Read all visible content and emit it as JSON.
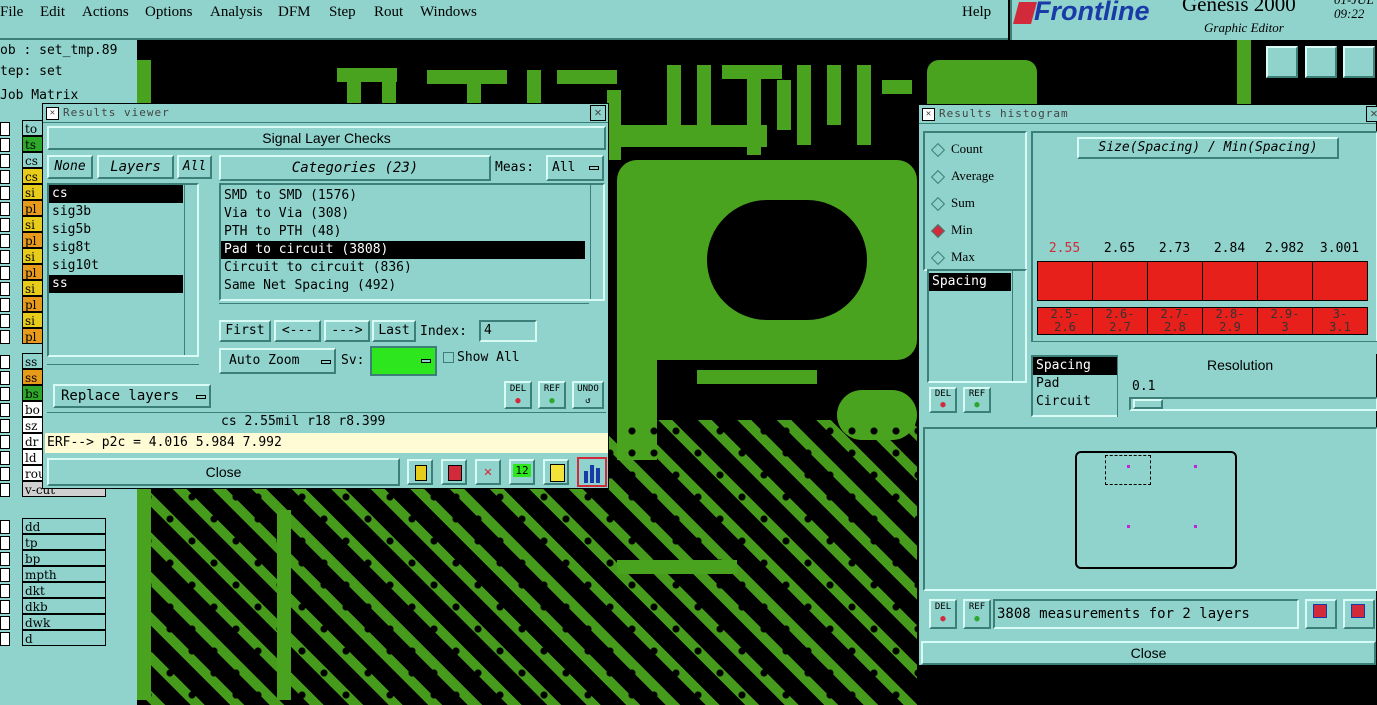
{
  "menubar": {
    "items": [
      "File",
      "Edit",
      "Actions",
      "Options",
      "Analysis",
      "DFM",
      "Step",
      "Rout",
      "Windows"
    ],
    "help": "Help"
  },
  "brand": {
    "logo": "Frontline",
    "product": "Genesis 2000",
    "subtitle": "Graphic Editor",
    "date_fragment": "01-JUL",
    "time": "09:22"
  },
  "left_panel": {
    "job_label": "ob : set_tmp.89",
    "step_label": "tep: set",
    "job_matrix": "Job Matrix",
    "layers_top": [
      "to",
      "ts",
      "cs",
      "cs",
      "si",
      "pl",
      "si",
      "pl",
      "si",
      "pl",
      "si",
      "pl",
      "si",
      "pl"
    ],
    "layers_mid": [
      "ss",
      "ss",
      "bs",
      "bo",
      "sz",
      "dr",
      "ld",
      "rou",
      "v-cut"
    ],
    "layers_bottom": [
      "dd",
      "tp",
      "bp",
      "mpth",
      "dkt",
      "dkb",
      "dwk",
      "d"
    ]
  },
  "results_viewer": {
    "title": "Results viewer",
    "header": "Signal Layer Checks",
    "none_btn": "None",
    "layers_btn": "Layers",
    "all_btn": "All",
    "categories_btn": "Categories (23)",
    "meas_label": "Meas:",
    "meas_value": "All",
    "layers": [
      {
        "name": "cs",
        "selected": true
      },
      {
        "name": "sig3b",
        "selected": false
      },
      {
        "name": "sig5b",
        "selected": false
      },
      {
        "name": "sig8t",
        "selected": false
      },
      {
        "name": "sig10t",
        "selected": false
      },
      {
        "name": "ss",
        "selected": true
      }
    ],
    "categories": [
      {
        "name": "SMD to SMD (1576)",
        "selected": false
      },
      {
        "name": "Via to Via (308)",
        "selected": false
      },
      {
        "name": "PTH to PTH (48)",
        "selected": false
      },
      {
        "name": "Pad to circuit (3808)",
        "selected": true
      },
      {
        "name": "Circuit to circuit (836)",
        "selected": false
      },
      {
        "name": "Same Net Spacing (492)",
        "selected": false
      }
    ],
    "first_btn": "First",
    "prev_btn": "<---",
    "next_btn": "--->",
    "last_btn": "Last",
    "index_label": "Index:",
    "index_value": "4",
    "auto_zoom": "Auto Zoom",
    "sv_label": "Sv:",
    "show_all": "Show All",
    "replace_layers": "Replace layers",
    "del": "DEL",
    "ref": "REF",
    "undo": "UNDO",
    "status_line": "cs 2.55mil  r18  r8.399",
    "erf_line": "ERF--> p2c = 4.016 5.984 7.992",
    "close": "Close",
    "sv_color": "#2ee61e"
  },
  "results_histogram": {
    "title": "Results histogram",
    "radio": [
      {
        "label": "Count",
        "on": false
      },
      {
        "label": "Average",
        "on": false
      },
      {
        "label": "Sum",
        "on": false
      },
      {
        "label": "Min",
        "on": true
      },
      {
        "label": "Max",
        "on": false
      }
    ],
    "type_list": [
      "Spacing"
    ],
    "chart_title": "Size(Spacing) / Min(Spacing)",
    "bars": [
      {
        "value": "2.55",
        "range_top": "2.5-",
        "range_bot": "2.6"
      },
      {
        "value": "2.65",
        "range_top": "2.6-",
        "range_bot": "2.7"
      },
      {
        "value": "2.73",
        "range_top": "2.7-",
        "range_bot": "2.8"
      },
      {
        "value": "2.84",
        "range_top": "2.8-",
        "range_bot": "2.9"
      },
      {
        "value": "2.982",
        "range_top": "2.9-",
        "range_bot": "3"
      },
      {
        "value": "3.001",
        "range_top": "3-",
        "range_bot": "3.1"
      }
    ],
    "size_list": [
      "Spacing",
      "Pad",
      "Circuit"
    ],
    "resolution_label": "Resolution",
    "resolution_value": "0.1",
    "del": "DEL",
    "ref": "REF",
    "measurements": "3808 measurements for 2 layers",
    "close": "Close",
    "bar_color": "#e8201b"
  }
}
